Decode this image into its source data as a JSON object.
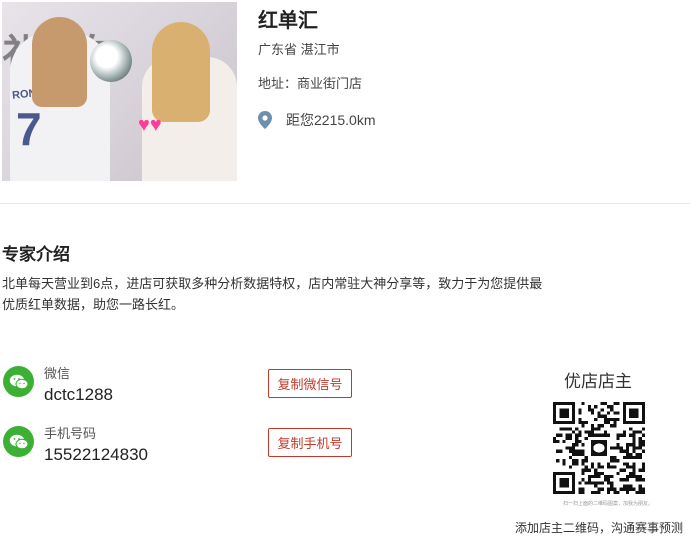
{
  "shop": {
    "name": "红单汇",
    "region": "广东省 湛江市",
    "address": "地址：商业街门店",
    "distance": "距您2215.0km"
  },
  "photo": {
    "jersey_name": "RONALDO",
    "jersey_number": "7"
  },
  "intro": {
    "title": "专家介绍",
    "text_line1": "北单每天营业到6点，进店可获取多种分析数据特权，店内常驻大神分享等，致力于为您提供最",
    "text_line2": "优质红单数据，助您一路长红。"
  },
  "contacts": {
    "wechat_label": "微信",
    "wechat_value": "dctc1288",
    "copy_wechat": "复制微信号",
    "phone_label": "手机号码",
    "phone_value": "15522124830",
    "copy_phone": "复制手机号"
  },
  "qr": {
    "title": "优店店主",
    "small_text": "扫一扫上面的二维码图案，加我为朋友。",
    "caption": "添加店主二维码，沟通赛事预测"
  },
  "colors": {
    "accent_red": "#c0392b",
    "wechat_green": "#3cb034",
    "pin_blue": "#6d8fb0"
  },
  "icons": [
    "location-pin-icon",
    "wechat-icon",
    "phone-wechat-icon",
    "qr-code"
  ]
}
